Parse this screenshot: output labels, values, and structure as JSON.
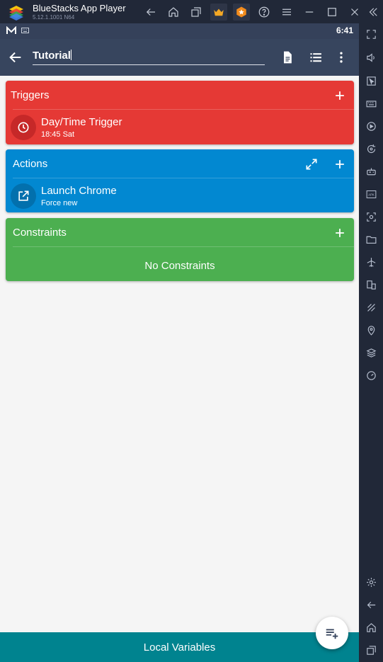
{
  "window": {
    "title": "BlueStacks App Player",
    "version": "5.12.1.1001 N64"
  },
  "status_bar": {
    "time": "6:41"
  },
  "app_bar": {
    "macro_name": "Tutorial"
  },
  "triggers": {
    "header": "Triggers",
    "color": "#e53935",
    "items": [
      {
        "title": "Day/Time Trigger",
        "subtitle": "18:45 Sat",
        "icon": "clock-icon"
      }
    ]
  },
  "actions": {
    "header": "Actions",
    "color": "#0288d1",
    "items": [
      {
        "title": "Launch Chrome",
        "subtitle": "Force new",
        "icon": "open-in-new-icon"
      }
    ]
  },
  "constraints": {
    "header": "Constraints",
    "color": "#4caf50",
    "empty_text": "No Constraints"
  },
  "bottom_bar": {
    "label": "Local Variables",
    "color": "#00838f"
  }
}
